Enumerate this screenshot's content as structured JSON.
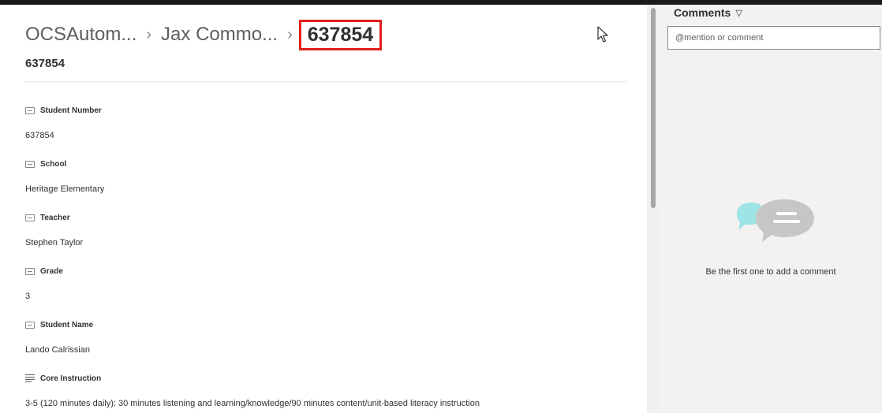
{
  "breadcrumb": {
    "items": [
      "OCSAutom...",
      "Jax Commo..."
    ],
    "separator": "›",
    "current": "637854"
  },
  "item_title": "637854",
  "fields": [
    {
      "label": "Student Number",
      "value": "637854",
      "icon": "text-field-icon"
    },
    {
      "label": "School",
      "value": "Heritage Elementary",
      "icon": "text-field-icon"
    },
    {
      "label": "Teacher",
      "value": "Stephen Taylor",
      "icon": "text-field-icon"
    },
    {
      "label": "Grade",
      "value": "3",
      "icon": "text-field-icon"
    },
    {
      "label": "Student Name",
      "value": "Lando Calrissian",
      "icon": "text-field-icon"
    },
    {
      "label": "Core Instruction",
      "value": "3-5 (120 minutes daily): 30 minutes listening and learning/knowledge/90 minutes content/unit-based literacy instruction",
      "icon": "multiline-text-icon"
    }
  ],
  "comments": {
    "header": "Comments",
    "placeholder": "@mention or comment",
    "empty_message": "Be the first one to add a comment"
  },
  "colors": {
    "highlight_box": "#e0201b",
    "bubble_teal": "#9ee3e6",
    "bubble_gray": "#c8c6c4"
  }
}
